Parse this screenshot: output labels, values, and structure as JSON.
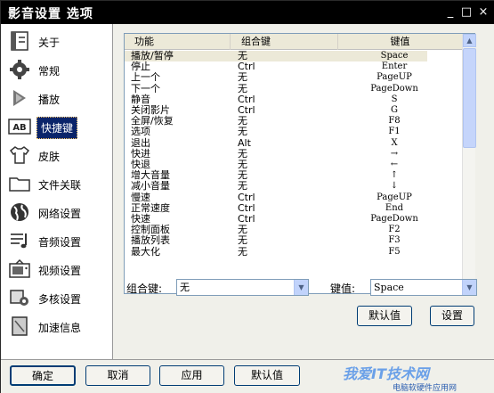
{
  "window": {
    "title": "影音设置 选项",
    "min_glyph": "_",
    "max_glyph": "□",
    "close_glyph": "×"
  },
  "sidebar": {
    "items": [
      {
        "label": "关于",
        "icon": "info-book-icon"
      },
      {
        "label": "常规",
        "icon": "gear-icon"
      },
      {
        "label": "播放",
        "icon": "play-arrow-icon"
      },
      {
        "label": "快捷键",
        "icon": "keyboard-ab-icon",
        "active": true
      },
      {
        "label": "皮肤",
        "icon": "shirt-icon"
      },
      {
        "label": "文件关联",
        "icon": "folder-icon"
      },
      {
        "label": "网络设置",
        "icon": "globe-icon"
      },
      {
        "label": "音频设置",
        "icon": "music-note-icon"
      },
      {
        "label": "视频设置",
        "icon": "tv-icon"
      },
      {
        "label": "多核设置",
        "icon": "cpu-gear-icon"
      },
      {
        "label": "加速信息",
        "icon": "document-icon"
      }
    ]
  },
  "table": {
    "headers": [
      "功能",
      "组合键",
      "键值"
    ],
    "rows": [
      [
        "播放/暂停",
        "无",
        "Space"
      ],
      [
        "停止",
        "Ctrl",
        "Enter"
      ],
      [
        "上一个",
        "无",
        "PageUP"
      ],
      [
        "下一个",
        "无",
        "PageDown"
      ],
      [
        "静音",
        "Ctrl",
        "S"
      ],
      [
        "关闭影片",
        "Ctrl",
        "G"
      ],
      [
        "全屏/恢复",
        "无",
        "F8"
      ],
      [
        "选项",
        "无",
        "F1"
      ],
      [
        "退出",
        "Alt",
        "X"
      ],
      [
        "快进",
        "无",
        "→"
      ],
      [
        "快退",
        "无",
        "←"
      ],
      [
        "增大音量",
        "无",
        "↑"
      ],
      [
        "减小音量",
        "无",
        "↓"
      ],
      [
        "慢速",
        "Ctrl",
        "PageUP"
      ],
      [
        "正常速度",
        "Ctrl",
        "End"
      ],
      [
        "快速",
        "Ctrl",
        "PageDown"
      ],
      [
        "控制面板",
        "无",
        "F2"
      ],
      [
        "播放列表",
        "无",
        "F3"
      ],
      [
        "最大化",
        "无",
        "F5"
      ]
    ],
    "selected_row": 0
  },
  "editor": {
    "combo_label": "组合键:",
    "combo_value": "无",
    "key_label": "键值:",
    "key_value": "Space",
    "default_button": "默认值",
    "set_button": "设置"
  },
  "footer": {
    "ok": "确定",
    "cancel": "取消",
    "apply": "应用",
    "default": "默认值"
  },
  "watermark": {
    "text": "我爱IT技术网",
    "sub": "电脑软硬件应用网"
  }
}
